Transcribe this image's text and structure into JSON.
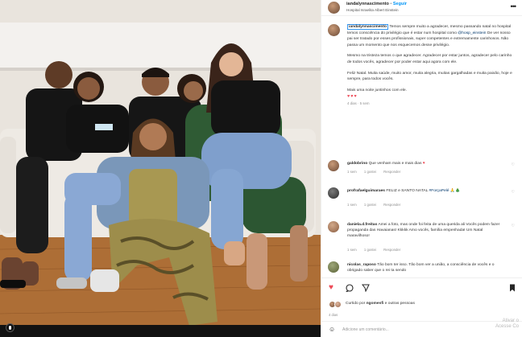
{
  "post_header": {
    "username": "iandalynnascimento",
    "separator": "•",
    "follow_label": "Seguir",
    "location": "Hospital Israelita Albert Einstein"
  },
  "caption": {
    "username": "iandalynnascimento",
    "paragraph_1": "Temos sempre muito a agradecer, mesmo passando natal no hospital temos consciência do privilégio que é estar num hospital como",
    "mention": "@hosp_einstein",
    "paragraph_1_end": "De ver nosso pai ser tratado por esses profissionais, super competentes e extremamente carinhosos.",
    "paragraph_1_last": "Não passa um momento que nos esquecemos desse privilégio.",
    "paragraph_2": "Mesmo na tristeza temos o que agradecer. Agradecer por estar juntos, agradecer pelo carinho de todos vocês, agradecer por poder estar aqui agora com ele.",
    "paragraph_3": "Feliz Natal. Muita saúde, muito amor, muita alegria, muitas gargalhadas e muita paixão, hoje e sempre, para todos vocês.",
    "paragraph_4": "Mais uma noite juntinhos com ele.",
    "hearts": "♥♥♥",
    "time": "4 dias · 5 sem"
  },
  "comments": [
    {
      "username": "galdobrino",
      "text": "Que venham mais e mais dias",
      "emoji": "♥",
      "time": "1 sem",
      "likes": "1 gostei",
      "reply": "Responder"
    },
    {
      "username": "profrafaelguimaraes",
      "text": "FELIZ e SANTO NATAL",
      "hashtag": "#ForçaPelé",
      "emoji": "🙏🎄",
      "time": "1 sem",
      "likes": "1 gostei",
      "reply": "Responder"
    },
    {
      "username": "daniela.d.freitas",
      "text": "Amei a foto, mas onde foi feita de uma querida ali Vocês podem fazer propaganda das Havaianas! Kkkkk Amo vocês, família empenhada! Um Natal maravilhoso!",
      "time": "1 sem",
      "likes": "1 gostei",
      "reply": "Responder"
    },
    {
      "username": "nicolas_raposo",
      "text": "Tão bom ter isso. Tão bom ver a união, a consciência de vocês e o obrigado saber que o rei ta sendo",
      "time": "",
      "likes": "",
      "reply": ""
    }
  ],
  "actions": {
    "like_icon": "heart-icon",
    "comment_icon": "comment-icon",
    "share_icon": "send-icon",
    "save_icon": "bookmark-icon"
  },
  "likes_line": {
    "prefix": "Curtido por",
    "user": "ngomesfi",
    "suffix": "e outras pessoas"
  },
  "date": "4 dias",
  "add_comment": {
    "placeholder": "Adicione um comentário..."
  },
  "watermark": {
    "line1": "Ativar o",
    "line2": "Acesse Co"
  },
  "colors": {
    "link_blue": "#0095f6",
    "like_red": "#ed4956",
    "muted_gray": "#8e8e8e"
  }
}
